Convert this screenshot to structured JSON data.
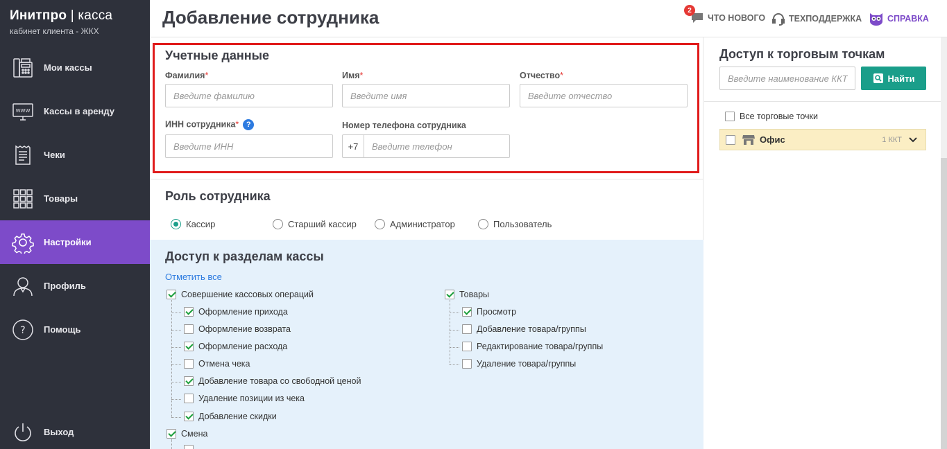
{
  "brand": {
    "name": "Инитпро",
    "product": "касса",
    "subtitle": "кабинет клиента - ЖКХ"
  },
  "sidebar": {
    "items": [
      {
        "label": "Мои кассы",
        "icon": "cash-register-icon"
      },
      {
        "label": "Кассы в аренду",
        "icon": "www-monitor-icon"
      },
      {
        "label": "Чеки",
        "icon": "receipt-icon"
      },
      {
        "label": "Товары",
        "icon": "grid-icon"
      },
      {
        "label": "Настройки",
        "icon": "gear-icon",
        "active": true
      },
      {
        "label": "Профиль",
        "icon": "user-icon"
      },
      {
        "label": "Помощь",
        "icon": "question-icon"
      }
    ],
    "logout": {
      "label": "Выход",
      "icon": "power-icon"
    }
  },
  "header": {
    "title": "Добавление сотрудника",
    "whats_new": {
      "label": "ЧТО НОВОГО",
      "badge": "2"
    },
    "support": {
      "label": "ТЕХПОДДЕРЖКА"
    },
    "help": {
      "label": "СПРАВКА"
    }
  },
  "credentials": {
    "title": "Учетные данные",
    "last_name": {
      "label": "Фамилия",
      "placeholder": "Введите фамилию",
      "value": ""
    },
    "first_name": {
      "label": "Имя",
      "placeholder": "Введите имя",
      "value": ""
    },
    "middle_name": {
      "label": "Отчество",
      "placeholder": "Введите отчество",
      "value": ""
    },
    "inn": {
      "label": "ИНН сотрудника",
      "placeholder": "Введите ИНН",
      "value": ""
    },
    "phone": {
      "label": "Номер телефона сотрудника",
      "prefix": "+7",
      "placeholder": "Введите телефон",
      "value": ""
    },
    "required_mark": "*",
    "help_mark": "?"
  },
  "role": {
    "title": "Роль сотрудника",
    "options": [
      {
        "label": "Кассир",
        "selected": true
      },
      {
        "label": "Старший кассир",
        "selected": false
      },
      {
        "label": "Администратор",
        "selected": false
      },
      {
        "label": "Пользователь",
        "selected": false
      }
    ]
  },
  "access": {
    "title": "Доступ к разделам кассы",
    "select_all": "Отметить все",
    "cash_ops": {
      "label": "Совершение кассовых операций",
      "checked": true,
      "children": [
        {
          "label": "Оформление прихода",
          "checked": true
        },
        {
          "label": "Оформление возврата",
          "checked": false
        },
        {
          "label": "Оформление расхода",
          "checked": true
        },
        {
          "label": "Отмена чека",
          "checked": false
        },
        {
          "label": "Добавление товара со свободной ценой",
          "checked": true
        },
        {
          "label": "Удаление позиции из чека",
          "checked": false
        },
        {
          "label": "Добавление скидки",
          "checked": true
        }
      ]
    },
    "goods": {
      "label": "Товары",
      "checked": true,
      "children": [
        {
          "label": "Просмотр",
          "checked": true
        },
        {
          "label": "Добавление товара/группы",
          "checked": false
        },
        {
          "label": "Редактирование товара/группы",
          "checked": false
        },
        {
          "label": "Удаление товара/группы",
          "checked": false
        }
      ]
    },
    "shift": {
      "label": "Смена",
      "checked": true
    }
  },
  "stores": {
    "title": "Доступ к торговым точкам",
    "search_placeholder": "Введите наименование ККТ",
    "find_label": "Найти",
    "all_label": "Все торговые точки",
    "items": [
      {
        "name": "Офис",
        "count": "1 ККТ"
      }
    ]
  },
  "colors": {
    "sidebar": "#2e313b",
    "accent": "#7d4bc9",
    "teal": "#1a9e8a",
    "highlight": "#e01b1b"
  }
}
